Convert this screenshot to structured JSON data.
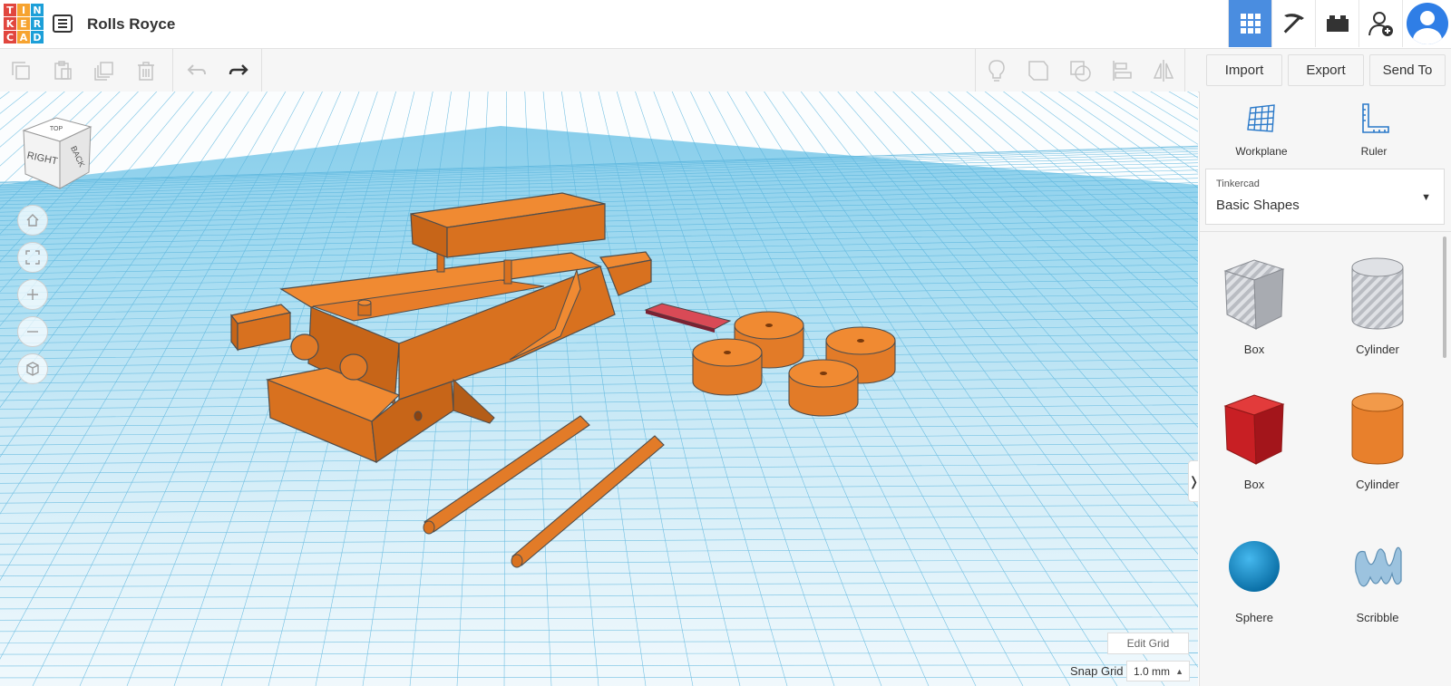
{
  "app": {
    "logo_letters": [
      "T",
      "I",
      "N",
      "K",
      "E",
      "R",
      "C",
      "A",
      "D"
    ],
    "logo_colors": [
      "#e1463e",
      "#f6a330",
      "#1c9fd8",
      "#e1463e",
      "#f6a330",
      "#1c9fd8",
      "#e1463e",
      "#f6a330",
      "#1c9fd8"
    ],
    "title": "Rolls Royce",
    "accent": "#4a8de0"
  },
  "top_nav": {
    "items": [
      {
        "name": "3d-design-view",
        "icon": "grid-icon",
        "active": true
      },
      {
        "name": "minecraft-view",
        "icon": "pickaxe-icon",
        "active": false
      },
      {
        "name": "brick-view",
        "icon": "brick-icon",
        "active": false
      },
      {
        "name": "add-user",
        "icon": "add-user-icon",
        "active": false
      }
    ],
    "avatar_icon": "user-avatar-icon"
  },
  "toolbar": {
    "edit_tools": [
      "copy-icon",
      "paste-icon",
      "duplicate-icon",
      "delete-icon"
    ],
    "history_tools": [
      "undo-icon",
      "redo-icon"
    ],
    "shape_tools": [
      "lightbulb-icon",
      "group-icon",
      "ungroup-icon",
      "align-icon",
      "mirror-icon"
    ],
    "import_label": "Import",
    "export_label": "Export",
    "send_label": "Send To"
  },
  "viewcube": {
    "faces": [
      "TOP",
      "RIGHT",
      "BACK"
    ]
  },
  "view_controls": [
    "home-icon",
    "fit-icon",
    "zoom-in-icon",
    "zoom-out-icon",
    "perspective-icon"
  ],
  "workspace": {
    "edit_grid_label": "Edit Grid",
    "snap_grid_label": "Snap Grid",
    "snap_grid_value": "1.0 mm",
    "model_color": "#e8802c",
    "plate_color": "#d94a56"
  },
  "panel": {
    "workplane_label": "Workplane",
    "ruler_label": "Ruler",
    "library_source": "Tinkercad",
    "library_name": "Basic Shapes",
    "shapes": [
      {
        "label": "Box",
        "kind": "box-hole"
      },
      {
        "label": "Cylinder",
        "kind": "cylinder-hole"
      },
      {
        "label": "Box",
        "kind": "box"
      },
      {
        "label": "Cylinder",
        "kind": "cylinder"
      },
      {
        "label": "Sphere",
        "kind": "sphere"
      },
      {
        "label": "Scribble",
        "kind": "scribble"
      }
    ]
  }
}
